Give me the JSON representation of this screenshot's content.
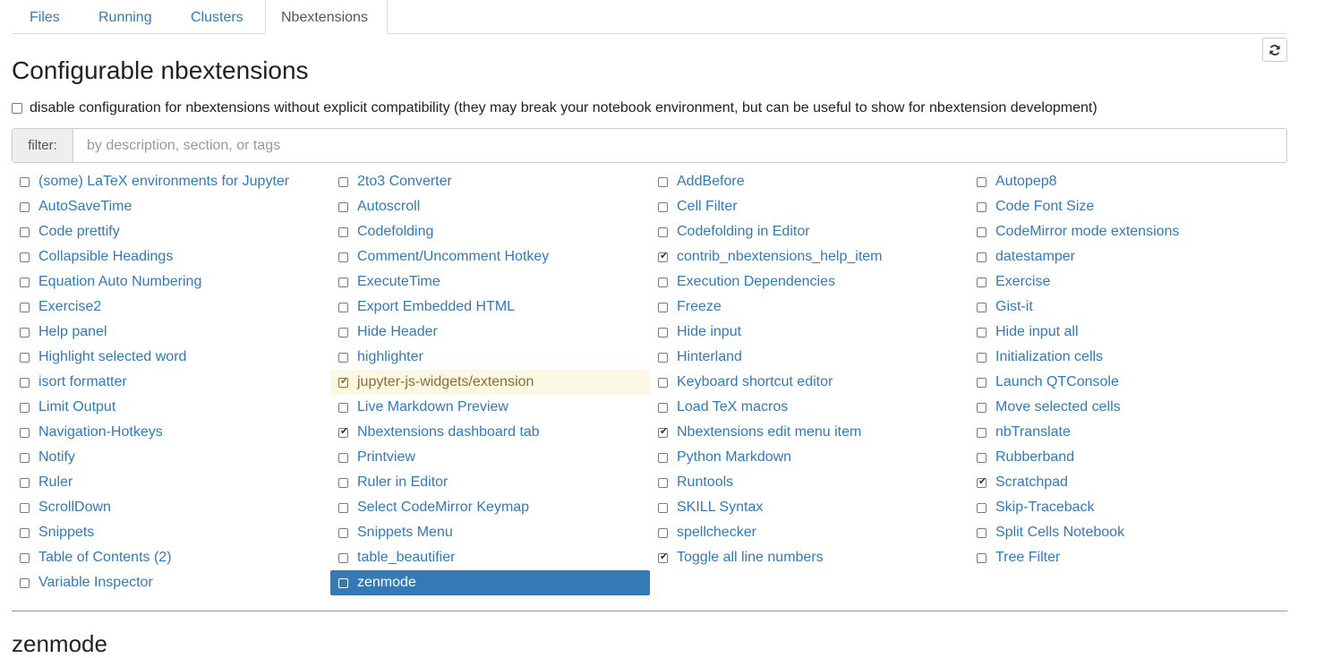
{
  "tabs": [
    {
      "label": "Files",
      "active": false
    },
    {
      "label": "Running",
      "active": false
    },
    {
      "label": "Clusters",
      "active": false
    },
    {
      "label": "Nbextensions",
      "active": true
    }
  ],
  "page_title": "Configurable nbextensions",
  "compat": {
    "label": "disable configuration for nbextensions without explicit compatibility (they may break your notebook environment, but can be useful to show for nbextension development)",
    "checked": false
  },
  "filter": {
    "label": "filter:",
    "placeholder": "by description, section, or tags",
    "value": ""
  },
  "refresh_icon": "refresh-icon",
  "extensions": [
    [
      {
        "label": "(some) LaTeX environments for Jupyter",
        "checked": false
      },
      {
        "label": "AutoSaveTime",
        "checked": false
      },
      {
        "label": "Code prettify",
        "checked": false
      },
      {
        "label": "Collapsible Headings",
        "checked": false
      },
      {
        "label": "Equation Auto Numbering",
        "checked": false
      },
      {
        "label": "Exercise2",
        "checked": false
      },
      {
        "label": "Help panel",
        "checked": false
      },
      {
        "label": "Highlight selected word",
        "checked": false
      },
      {
        "label": "isort formatter",
        "checked": false
      },
      {
        "label": "Limit Output",
        "checked": false
      },
      {
        "label": "Navigation-Hotkeys",
        "checked": false
      },
      {
        "label": "Notify",
        "checked": false
      },
      {
        "label": "Ruler",
        "checked": false
      },
      {
        "label": "ScrollDown",
        "checked": false
      },
      {
        "label": "Snippets",
        "checked": false
      },
      {
        "label": "Table of Contents (2)",
        "checked": false
      },
      {
        "label": "Variable Inspector",
        "checked": false
      }
    ],
    [
      {
        "label": "2to3 Converter",
        "checked": false
      },
      {
        "label": "Autoscroll",
        "checked": false
      },
      {
        "label": "Codefolding",
        "checked": false
      },
      {
        "label": "Comment/Uncomment Hotkey",
        "checked": false
      },
      {
        "label": "ExecuteTime",
        "checked": false
      },
      {
        "label": "Export Embedded HTML",
        "checked": false
      },
      {
        "label": "Hide Header",
        "checked": false
      },
      {
        "label": "highlighter",
        "checked": false
      },
      {
        "label": "jupyter-js-widgets/extension",
        "checked": true,
        "state": "hover"
      },
      {
        "label": "Live Markdown Preview",
        "checked": false
      },
      {
        "label": "Nbextensions dashboard tab",
        "checked": true
      },
      {
        "label": "Printview",
        "checked": false
      },
      {
        "label": "Ruler in Editor",
        "checked": false
      },
      {
        "label": "Select CodeMirror Keymap",
        "checked": false
      },
      {
        "label": "Snippets Menu",
        "checked": false
      },
      {
        "label": "table_beautifier",
        "checked": false
      },
      {
        "label": "zenmode",
        "checked": false,
        "state": "selected"
      }
    ],
    [
      {
        "label": "AddBefore",
        "checked": false
      },
      {
        "label": "Cell Filter",
        "checked": false
      },
      {
        "label": "Codefolding in Editor",
        "checked": false
      },
      {
        "label": "contrib_nbextensions_help_item",
        "checked": true
      },
      {
        "label": "Execution Dependencies",
        "checked": false
      },
      {
        "label": "Freeze",
        "checked": false
      },
      {
        "label": "Hide input",
        "checked": false
      },
      {
        "label": "Hinterland",
        "checked": false
      },
      {
        "label": "Keyboard shortcut editor",
        "checked": false
      },
      {
        "label": "Load TeX macros",
        "checked": false
      },
      {
        "label": "Nbextensions edit menu item",
        "checked": true
      },
      {
        "label": "Python Markdown",
        "checked": false
      },
      {
        "label": "Runtools",
        "checked": false
      },
      {
        "label": "SKILL Syntax",
        "checked": false
      },
      {
        "label": "spellchecker",
        "checked": false
      },
      {
        "label": "Toggle all line numbers",
        "checked": true
      }
    ],
    [
      {
        "label": "Autopep8",
        "checked": false
      },
      {
        "label": "Code Font Size",
        "checked": false
      },
      {
        "label": "CodeMirror mode extensions",
        "checked": false
      },
      {
        "label": "datestamper",
        "checked": false
      },
      {
        "label": "Exercise",
        "checked": false
      },
      {
        "label": "Gist-it",
        "checked": false
      },
      {
        "label": "Hide input all",
        "checked": false
      },
      {
        "label": "Initialization cells",
        "checked": false
      },
      {
        "label": "Launch QTConsole",
        "checked": false
      },
      {
        "label": "Move selected cells",
        "checked": false
      },
      {
        "label": "nbTranslate",
        "checked": false
      },
      {
        "label": "Rubberband",
        "checked": false
      },
      {
        "label": "Scratchpad",
        "checked": true
      },
      {
        "label": "Skip-Traceback",
        "checked": false
      },
      {
        "label": "Split Cells Notebook",
        "checked": false
      },
      {
        "label": "Tree Filter",
        "checked": false
      }
    ]
  ],
  "selected_title": "zenmode",
  "colors": {
    "link": "#337ab7",
    "selected_bg": "#337ab7",
    "hover_bg": "#fcf8e3",
    "hover_text": "#8a6d3b"
  }
}
